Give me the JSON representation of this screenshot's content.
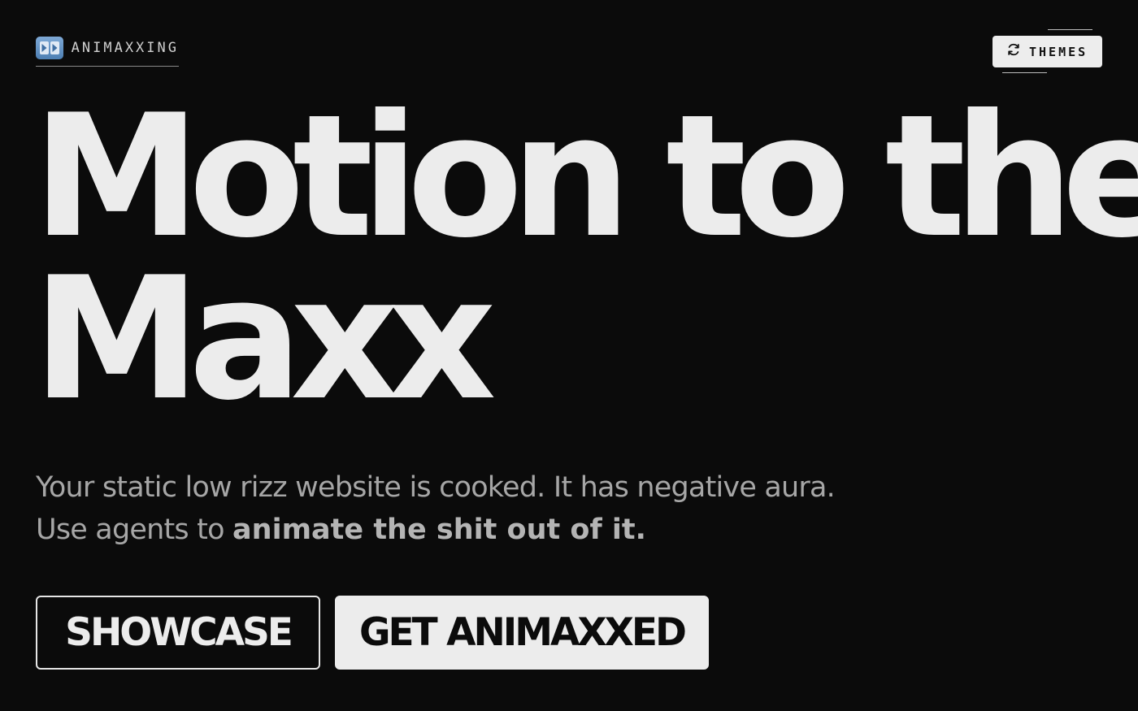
{
  "header": {
    "brand_name": "ANIMAXXING",
    "brand_icon": "fast-forward-icon",
    "themes_label": "THEMES",
    "themes_icon": "refresh-icon"
  },
  "hero": {
    "headline_line1": "Motion to the",
    "headline_line2": "Maxx",
    "subtitle_line1": "Your static low rizz website is cooked. It has negative aura.",
    "subtitle_line2_plain": "Use agents to ",
    "subtitle_line2_bold": "animate the shit out of it."
  },
  "actions": {
    "showcase_label": "SHOWCASE",
    "get_label": "GET ANIMAXXED"
  },
  "colors": {
    "background": "#0b0b0b",
    "text": "#ececec",
    "muted": "#a6a6a6",
    "brand_icon": "#6b97c8"
  }
}
